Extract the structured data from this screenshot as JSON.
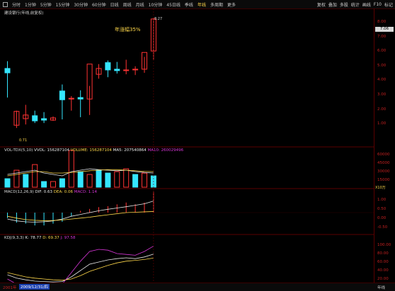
{
  "toolbar": {
    "left_items": [
      "分时",
      "1分钟",
      "5分钟",
      "15分钟",
      "30分钟",
      "60分钟",
      "日线",
      "周线",
      "月线",
      "10分钟",
      "45日线",
      "季线",
      "年线",
      "多周期",
      "更多"
    ],
    "active_item": "年线",
    "right_items": [
      "复权",
      "叠加",
      "多股",
      "统计",
      "画线",
      "F10",
      "标记"
    ]
  },
  "chart": {
    "title": "建设银行(年线,前复权)",
    "annotation": "年涨幅35%",
    "high_label": "8.27",
    "low_label": "0.71",
    "price_ticks": [
      "8.00",
      "7.00",
      "6.00",
      "5.00",
      "4.00",
      "3.00",
      "2.00",
      "1.00"
    ],
    "current_price_tag": "7.06",
    "candles": [
      {
        "o": 4.8,
        "h": 5.3,
        "l": 2.8,
        "c": 4.5
      },
      {
        "o": 0.9,
        "h": 1.9,
        "l": 0.71,
        "c": 1.85
      },
      {
        "o": 1.35,
        "h": 2.3,
        "l": 0.95,
        "c": 1.6
      },
      {
        "o": 1.55,
        "h": 1.9,
        "l": 1.05,
        "c": 1.2
      },
      {
        "o": 1.35,
        "h": 1.8,
        "l": 1.05,
        "c": 1.25
      },
      {
        "o": 1.25,
        "h": 1.5,
        "l": 1.2,
        "c": 1.4
      },
      {
        "o": 3.25,
        "h": 3.7,
        "l": 1.3,
        "c": 2.65
      },
      {
        "o": 2.7,
        "h": 2.9,
        "l": 1.9,
        "c": 2.75
      },
      {
        "o": 2.8,
        "h": 3.3,
        "l": 1.45,
        "c": 2.7
      },
      {
        "o": 2.7,
        "h": 3.6,
        "l": 1.6,
        "c": 5.1
      },
      {
        "o": 4.4,
        "h": 5.1,
        "l": 4.1,
        "c": 4.8
      },
      {
        "o": 5.2,
        "h": 5.35,
        "l": 4.2,
        "c": 4.7
      },
      {
        "o": 4.75,
        "h": 5.25,
        "l": 4.45,
        "c": 4.65
      },
      {
        "o": 4.65,
        "h": 5.4,
        "l": 4.4,
        "c": 4.7
      },
      {
        "o": 4.7,
        "h": 4.95,
        "l": 4.35,
        "c": 4.75
      },
      {
        "o": 4.75,
        "h": 5.6,
        "l": 4.5,
        "c": 5.9
      },
      {
        "o": 6.0,
        "h": 8.27,
        "l": 5.4,
        "c": 8.2
      }
    ]
  },
  "volume": {
    "header": {
      "name": "VOL-TDX(5,10)",
      "vvol": "VVOL: 156287104",
      "volume": "VOLUME: 156287104",
      "ma5": "MA5: 207540864",
      "ma10": "MA10: 260029496"
    },
    "ticks": [
      "60000",
      "45000",
      "30000",
      "15000"
    ],
    "unit": "X10万",
    "bars": [
      0.3,
      0.6,
      0.45,
      0.8,
      0.2,
      0.2,
      0.3,
      1.3,
      0.55,
      0.45,
      0.6,
      0.5,
      0.55,
      0.65,
      0.45,
      0.5,
      0.4
    ],
    "up": [
      false,
      true,
      false,
      true,
      false,
      true,
      false,
      true,
      false,
      true,
      false,
      false,
      true,
      true,
      false,
      true,
      false
    ]
  },
  "macd": {
    "header": {
      "name": "MACD(12,26,9)",
      "dif": "DIF: 0.63",
      "dea": "DEA: 0.06",
      "macd": "MACD: 1.14"
    },
    "ticks": [
      "1.00",
      "0.50",
      "0.00",
      "-0.50"
    ],
    "bars": [
      -0.3,
      -0.55,
      -0.6,
      -0.7,
      -0.7,
      -0.6,
      -0.5,
      -0.2,
      0.1,
      0.2,
      0.3,
      0.35,
      0.45,
      0.55,
      0.45,
      0.55,
      1.14
    ]
  },
  "kdj": {
    "header": {
      "name": "KDJ(9,3,3)",
      "k": "K: 78.77",
      "d": "D: 69.37",
      "j": "J: 97.58"
    },
    "ticks": [
      "100.00",
      "80.00",
      "60.00",
      "40.00",
      "20.00"
    ]
  },
  "bottom": {
    "year_start": "2001年",
    "date_highlight": "2009/12/31/四",
    "right_label": "年线"
  },
  "colors": {
    "up": "#ff3333",
    "down": "#35e6ff",
    "bg": "#000000",
    "grid": "#5a0000",
    "yellow": "#ffd84a",
    "magenta": "#d836d8",
    "white": "#e8e8e8"
  }
}
